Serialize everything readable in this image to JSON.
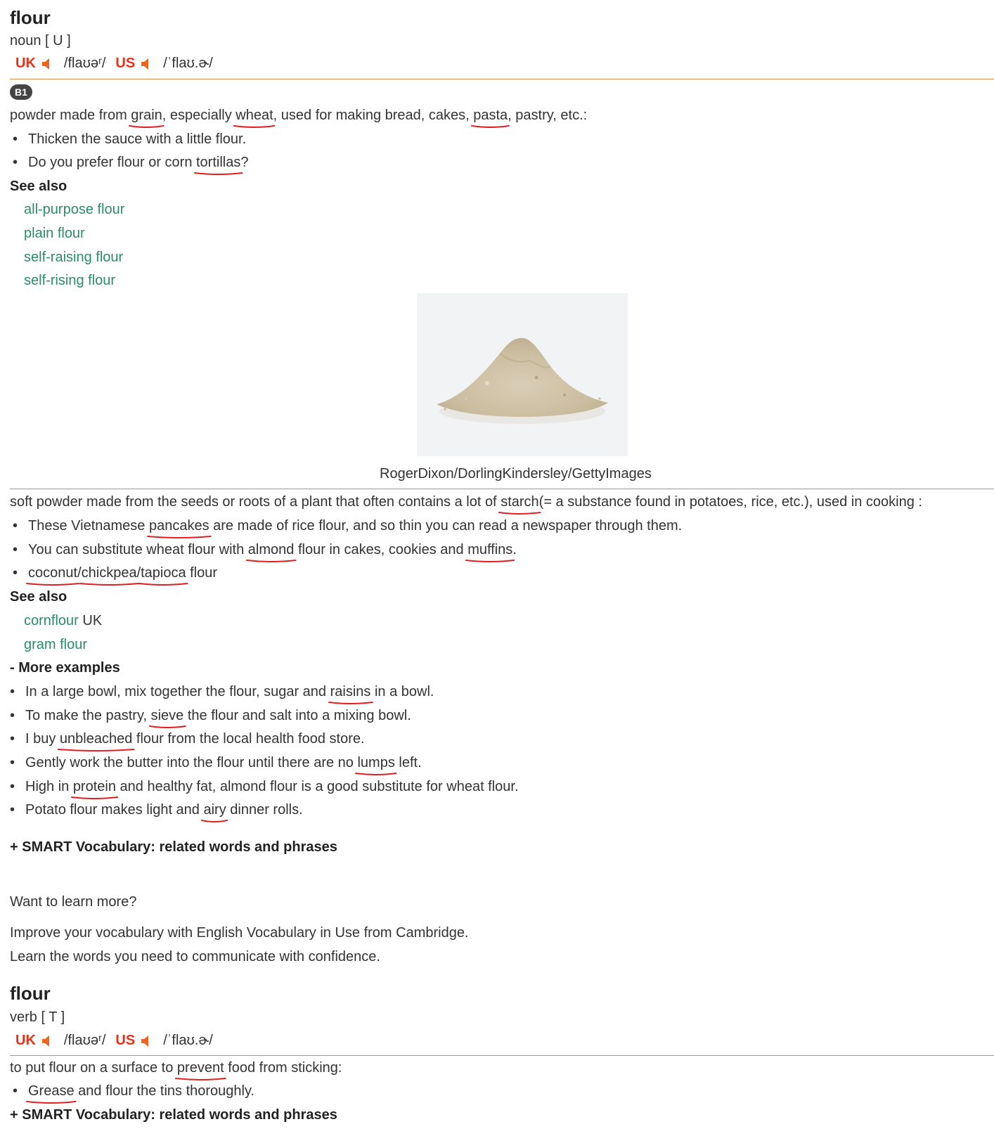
{
  "entry1": {
    "headword": "flour",
    "pos": "noun [ U ]",
    "uk_label": "UK",
    "uk_ipa": "/flaʊəʳ/",
    "us_label": "US",
    "us_ipa": "/ˈflaʊ.ɚ/",
    "sense1": {
      "level": "B1",
      "definition": {
        "t1": "powder made from ",
        "w1": "grain",
        "t2": ", especially ",
        "w2": "wheat",
        "t3": ", used for making bread, cakes, ",
        "w3": "pasta",
        "t4": ", pastry, etc.:"
      },
      "example1": "Thicken the sauce with a little flour.",
      "example2": {
        "t1": "Do you prefer flour or corn ",
        "w1": "tortillas",
        "t2": "?"
      },
      "see_also_label": "See also",
      "see_also": [
        "all-purpose flour",
        "plain flour",
        "self-raising flour",
        "self-rising flour"
      ]
    },
    "image_credit": "RogerDixon/DorlingKindersley/GettyImages",
    "sense2": {
      "definition": {
        "t1": "soft powder made from the seeds or roots of a plant that often contains a lot of ",
        "w1": "starch ",
        "t2": "(= a substance found in potatoes, rice, etc.), used in cooking :"
      },
      "example1": {
        "t1": "These Vietnamese ",
        "w1": "pancakes",
        "t2": " are made of rice flour, and so thin you can read a newspaper through them."
      },
      "example2": {
        "t1": "You can substitute wheat flour with ",
        "w1": "almond",
        "t2": " flour in cakes, cookies and ",
        "w2": "muffins",
        "t3": "."
      },
      "example3": {
        "w1": "coconut",
        "s1": "/",
        "w2": "chickpea",
        "s2": "/",
        "w3": "tapioca",
        "t1": " flour"
      },
      "see_also_label": "See also",
      "see_also_1": "cornflour",
      "see_also_1_region": " UK",
      "see_also_2": "gram flour"
    },
    "more_examples_label": "- More examples",
    "more_examples": {
      "m1": {
        "t1": "In a large bowl, mix together the flour, sugar and ",
        "w1": "raisins",
        "t2": " in a bowl."
      },
      "m2": {
        "t1": "To make the pastry, ",
        "w1": "sieve",
        "t2": " the flour and salt into a mixing bowl."
      },
      "m3": {
        "t1": "I buy ",
        "w1": "unbleached",
        "t2": " flour from the local health food store."
      },
      "m4": {
        "t1": "Gently work the butter into the flour until there are no ",
        "w1": "lumps",
        "t2": " left."
      },
      "m5": {
        "t1": "High in ",
        "w1": "protein",
        "t2": " and healthy fat, almond flour is a good substitute for wheat flour."
      },
      "m6": {
        "t1": "Potato flour makes light and ",
        "w1": "airy",
        "t2": " dinner rolls."
      }
    },
    "smart_vocab": "+ SMART Vocabulary: related words and phrases"
  },
  "promo": {
    "heading": "Want to learn more?",
    "line1": "Improve your vocabulary with English Vocabulary in Use from Cambridge.",
    "line2": "Learn the words you need to communicate with confidence."
  },
  "entry2": {
    "headword": "flour",
    "pos": "verb [ T ]",
    "uk_label": "UK",
    "uk_ipa": "/flaʊəʳ/",
    "us_label": "US",
    "us_ipa": "/ˈflaʊ.ɚ/",
    "definition": {
      "t1": "to put flour on a surface to ",
      "w1": "prevent",
      "t2": " food from sticking:"
    },
    "example1": {
      "w1": "Grease",
      "t1": " and flour the tins thoroughly."
    },
    "smart_vocab": "+ SMART Vocabulary: related words and phrases"
  },
  "colors": {
    "region": "#e4321b",
    "speaker": "#f0651e",
    "link": "#2a8c6c",
    "rule": "#d88a4a",
    "underline": "#e02020"
  }
}
